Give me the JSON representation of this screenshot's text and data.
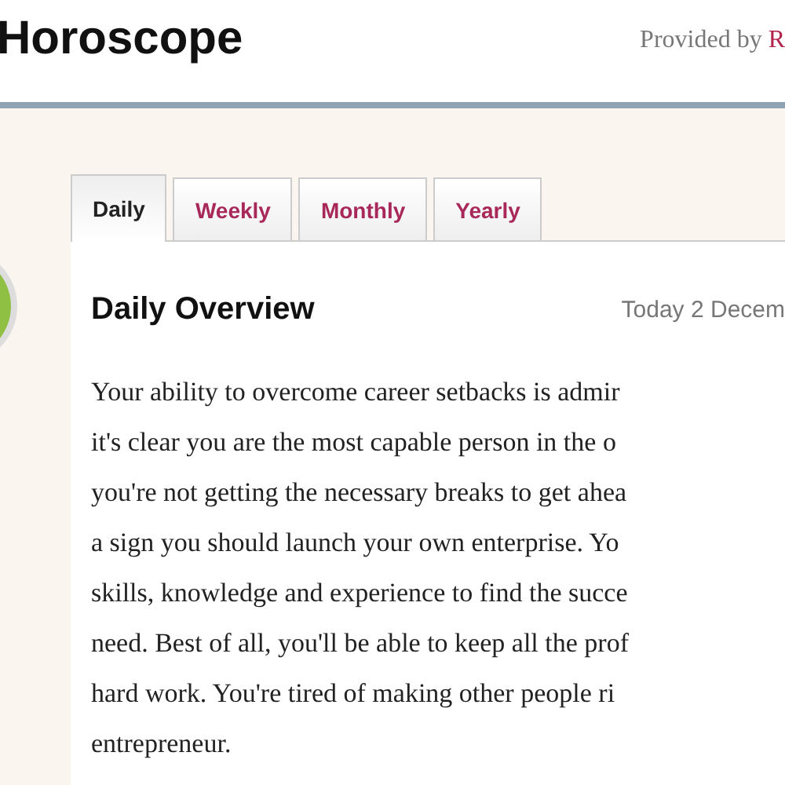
{
  "header": {
    "title": "Horoscope",
    "credit": "Provided by",
    "credit_link": "R"
  },
  "tabs": [
    {
      "label": "Daily",
      "selected": true
    },
    {
      "label": "Weekly",
      "selected": false
    },
    {
      "label": "Monthly",
      "selected": false
    },
    {
      "label": "Yearly",
      "selected": false
    }
  ],
  "overview": {
    "heading": "Daily Overview",
    "date": "Today 2 Decem",
    "lines": [
      "Your ability to overcome career setbacks is admir",
      "it's clear you are the most capable person in the o",
      "you're not getting the necessary breaks to get ahea",
      "a sign you should launch your own enterprise. Yo",
      "skills, knowledge and experience to find the succe",
      "need. Best of all, you'll be able to keep all the prof",
      "hard work. You're tired of making other people ri",
      "entrepreneur."
    ]
  }
}
